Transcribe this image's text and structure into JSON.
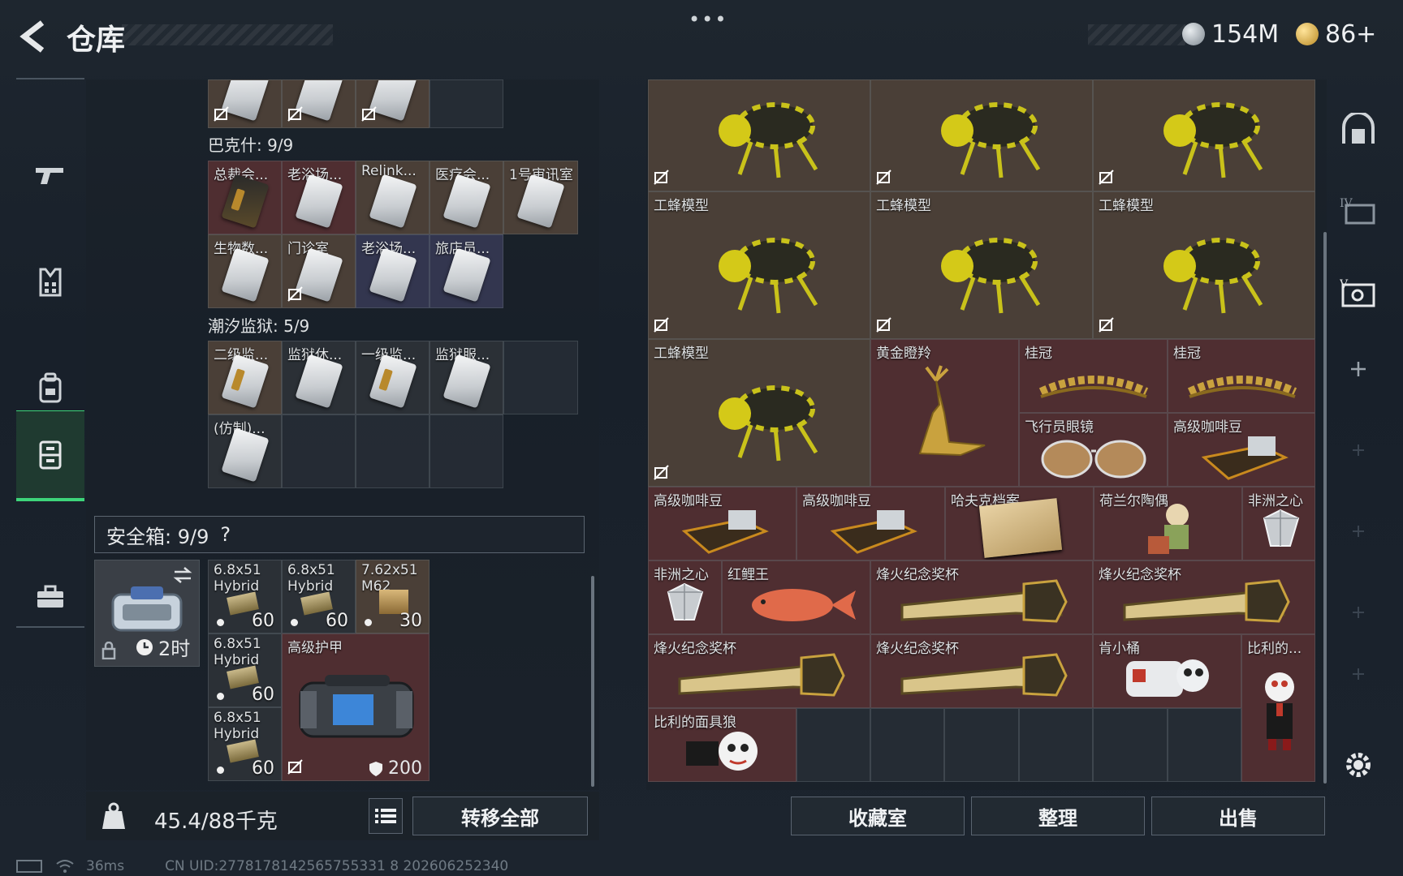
{
  "header": {
    "menu_dots": "•••",
    "title": "仓库",
    "currency_silver": "154M",
    "currency_gold": "86+"
  },
  "nav": {
    "items": [
      "weapons",
      "armor",
      "backpack",
      "storage",
      "briefcase"
    ],
    "active": "storage"
  },
  "left": {
    "section_bakeshi": "巴克什: 9/9",
    "bakeshi_items": [
      {
        "name": "总裁会..."
      },
      {
        "name": "老浴场..."
      },
      {
        "name": "Relink..."
      },
      {
        "name": "医疗会..."
      },
      {
        "name": "1号审讯室"
      },
      {
        "name": "生物数..."
      },
      {
        "name": "门诊室"
      },
      {
        "name": "老浴场..."
      },
      {
        "name": "旅店员..."
      }
    ],
    "section_chaoxi": "潮汐监狱: 5/9",
    "chaoxi_items": [
      {
        "name": "二级监..."
      },
      {
        "name": "监狱休..."
      },
      {
        "name": "一级监..."
      },
      {
        "name": "监狱服..."
      },
      {
        "name": "(仿制)..."
      }
    ],
    "safe_label": "安全箱: 9/9",
    "safe_help": "?",
    "safe_timer": "2时",
    "ammo": [
      {
        "line1": "6.8x51",
        "line2": "Hybrid",
        "count": "60"
      },
      {
        "line1": "6.8x51",
        "line2": "Hybrid",
        "count": "60"
      },
      {
        "line1": "7.62x51",
        "line2": "M62",
        "count": "30"
      },
      {
        "line1": "6.8x51",
        "line2": "Hybrid",
        "count": "60"
      },
      {
        "line1": "6.8x51",
        "line2": "Hybrid",
        "count": "60"
      }
    ],
    "armor": {
      "name": "高级护甲",
      "durability": "200"
    },
    "weight": "45.4/88千克",
    "transfer_all": "转移全部"
  },
  "right": {
    "bee_label": "工蜂模型",
    "items": {
      "golden_deer": "黄金瞪羚",
      "crown1": "桂冠",
      "crown2": "桂冠",
      "aviator": "飞行员眼镜",
      "coffee1": "高级咖啡豆",
      "coffee2": "高级咖啡豆",
      "coffee3": "高级咖啡豆",
      "harken": "哈夫克档案",
      "dutch": "荷兰尔陶偶",
      "heart1": "非洲之心",
      "heart2": "非洲之心",
      "koi": "红鲤王",
      "trophy1": "烽火纪念奖杯",
      "trophy2": "烽火纪念奖杯",
      "trophy3": "烽火纪念奖杯",
      "trophy4": "烽火纪念奖杯",
      "kenny": "肯小桶",
      "billy": "比利的...",
      "billy_mask": "比利的面具狼"
    },
    "btn_collection": "收藏室",
    "btn_sort": "整理",
    "btn_sell": "出售"
  },
  "footer": {
    "ping": "36ms",
    "uid": "CN UID:2778178142565755331 8 202606252340"
  },
  "colors": {
    "accent_green": "#3dd47a",
    "cell_red": "#4f2e31",
    "cell_brown": "#4a3f37"
  }
}
